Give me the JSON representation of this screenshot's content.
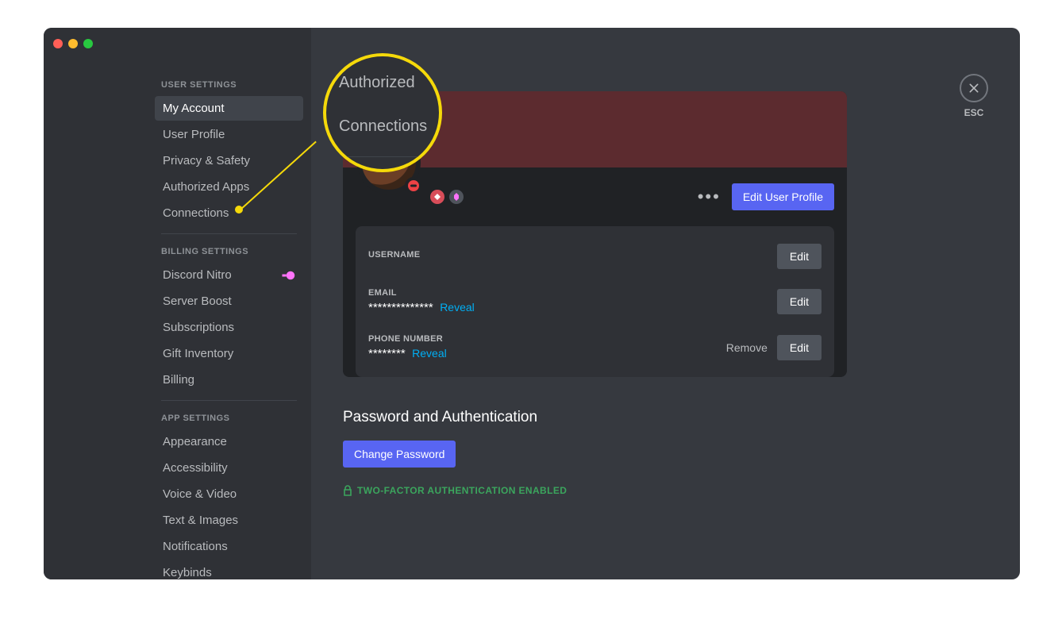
{
  "sidebar": {
    "sections": [
      {
        "title": "USER SETTINGS",
        "items": [
          {
            "label": "My Account",
            "active": true
          },
          {
            "label": "User Profile"
          },
          {
            "label": "Privacy & Safety"
          },
          {
            "label": "Authorized Apps"
          },
          {
            "label": "Connections"
          }
        ]
      },
      {
        "title": "BILLING SETTINGS",
        "items": [
          {
            "label": "Discord Nitro",
            "icon": "nitro"
          },
          {
            "label": "Server Boost"
          },
          {
            "label": "Subscriptions"
          },
          {
            "label": "Gift Inventory"
          },
          {
            "label": "Billing"
          }
        ]
      },
      {
        "title": "APP SETTINGS",
        "items": [
          {
            "label": "Appearance"
          },
          {
            "label": "Accessibility"
          },
          {
            "label": "Voice & Video"
          },
          {
            "label": "Text & Images"
          },
          {
            "label": "Notifications"
          },
          {
            "label": "Keybinds"
          }
        ]
      }
    ]
  },
  "close": {
    "esc": "ESC"
  },
  "callout": {
    "top": "Authorized",
    "bottom": "Connections"
  },
  "account": {
    "edit_profile": "Edit User Profile",
    "fields": {
      "username_label": "USERNAME",
      "username_value": "",
      "email_label": "EMAIL",
      "email_value": "**************",
      "phone_label": "PHONE NUMBER",
      "phone_value": "********"
    },
    "reveal": "Reveal",
    "edit": "Edit",
    "remove": "Remove"
  },
  "password_section": {
    "title": "Password and Authentication",
    "change": "Change Password",
    "tfa": "TWO-FACTOR AUTHENTICATION ENABLED"
  }
}
